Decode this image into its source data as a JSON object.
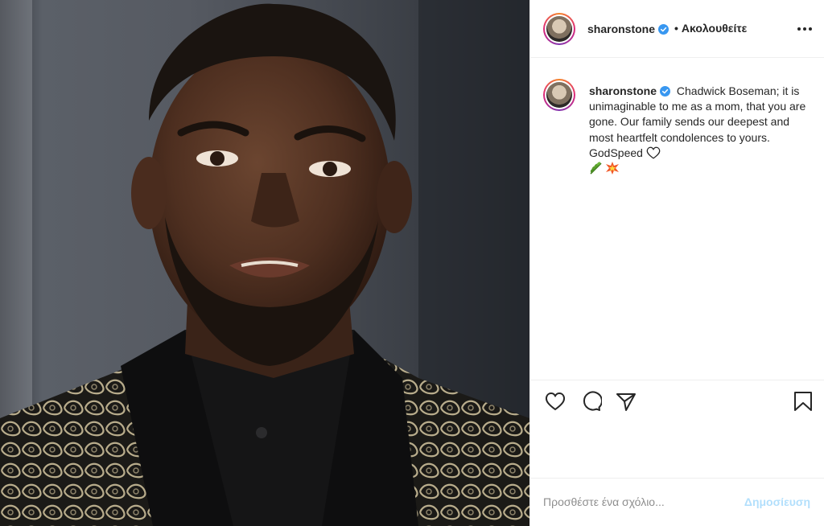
{
  "photo": {
    "description_icon": "portrait-photo"
  },
  "header": {
    "username": "sharonstone",
    "verified": true,
    "separator": "•",
    "follow_status": "Ακολουθείτε",
    "more_icon": "more-horizontal-icon"
  },
  "caption": {
    "username": "sharonstone",
    "text": "Chadwick Boseman; it is unimaginable to me as a mom, that you are gone. Our family sends our deepest and most heartfelt condolences to yours. GodSpeed",
    "emojis": [
      "white-heart-icon",
      "herb-emoji",
      "collision-emoji"
    ]
  },
  "actions": {
    "like_icon": "heart-icon",
    "comment_icon": "comment-icon",
    "share_icon": "share-icon",
    "save_icon": "bookmark-icon"
  },
  "comment": {
    "placeholder": "Προσθέστε ένα σχόλιο...",
    "post_label": "Δημοσίευση"
  },
  "colors": {
    "text": "#262626",
    "muted": "#8e8e8e",
    "verified": "#3897f0",
    "post_disabled": "#b2dffc",
    "border": "#efefef"
  }
}
